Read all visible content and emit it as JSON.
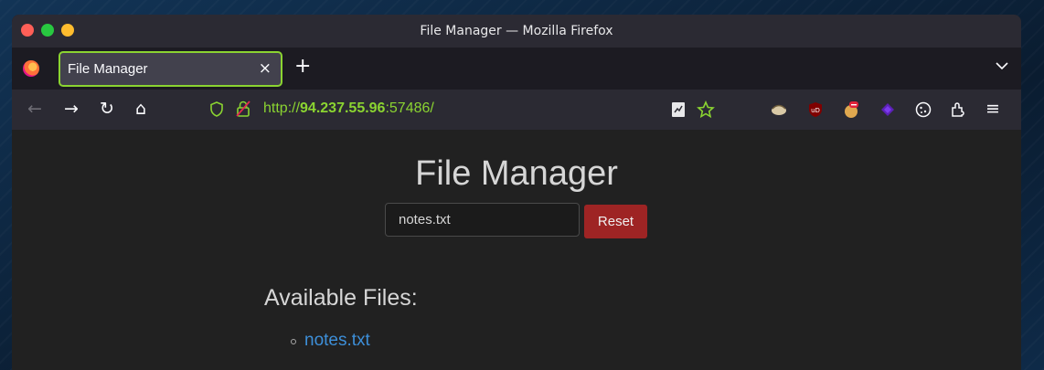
{
  "window": {
    "title": "File Manager — Mozilla Firefox"
  },
  "tabs": [
    {
      "label": "File Manager",
      "close": "×"
    }
  ],
  "tabstrip": {
    "new_tab": "+",
    "list_tabs": "⌄"
  },
  "navbar": {
    "back": "←",
    "forward": "→",
    "reload": "↻",
    "home": "⌂",
    "url": {
      "scheme": "http://",
      "host": "94.237.55.96",
      "port_path": ":57486/"
    },
    "menu": "≡"
  },
  "extensions": [
    "reader-view-icon",
    "bookmark-star-icon",
    "foxyproxy-icon",
    "ublock-origin-icon",
    "cookie-editor-icon",
    "wappalyzer-icon",
    "cookie-icon",
    "extensions-icon"
  ],
  "page": {
    "title": "File Manager",
    "search_value": "notes.txt",
    "reset_label": "Reset",
    "files_heading": "Available Files:",
    "files": [
      "notes.txt"
    ]
  },
  "colors": {
    "accent": "#8bd431",
    "reset_button": "#9e2424",
    "link": "#3d8fd9"
  }
}
